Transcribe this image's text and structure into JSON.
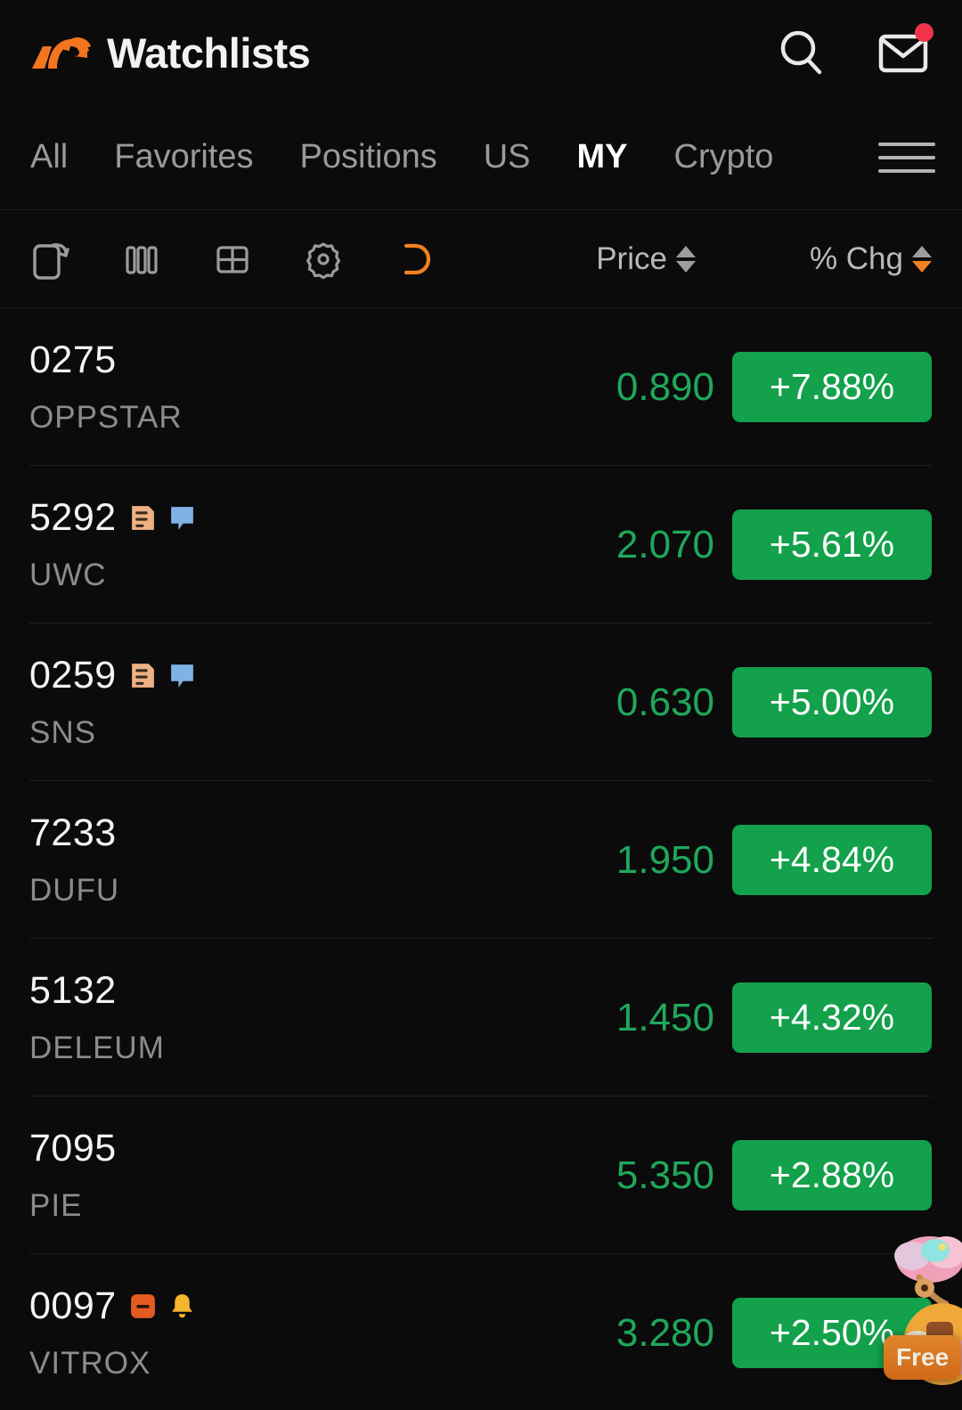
{
  "header": {
    "title": "Watchlists",
    "logo_icon": "moomoo-bull-logo",
    "search_icon": "search-icon",
    "mail_icon": "mail-icon",
    "mail_has_unread": true,
    "accent_color": "#f47520"
  },
  "tabs": {
    "items": [
      {
        "label": "All",
        "active": false
      },
      {
        "label": "Favorites",
        "active": false
      },
      {
        "label": "Positions",
        "active": false
      },
      {
        "label": "US",
        "active": false
      },
      {
        "label": "MY",
        "active": true
      },
      {
        "label": "Crypto",
        "active": false
      }
    ],
    "menu_icon": "hamburger-menu-icon"
  },
  "toolbar": {
    "icons": [
      {
        "name": "rotate-screen-icon",
        "active": false
      },
      {
        "name": "columns-view-icon",
        "active": false
      },
      {
        "name": "grid-view-icon",
        "active": false
      },
      {
        "name": "settings-gear-icon",
        "active": false
      },
      {
        "name": "undo-refresh-icon",
        "active": true
      }
    ],
    "sorts": [
      {
        "label": "Price",
        "direction": "none"
      },
      {
        "label": "% Chg",
        "direction": "desc"
      }
    ]
  },
  "colors": {
    "background": "#0b0b0c",
    "up_green": "#13a14b",
    "price_green": "#1fa85a",
    "divider": "#202023",
    "accent_orange": "#f08020",
    "badge_note": "#edb183",
    "badge_bubble": "#7fb2e5",
    "badge_minus": "#e35b22",
    "badge_bell": "#f5b52a"
  },
  "list": {
    "rows": [
      {
        "code": "0275",
        "name": "OPPSTAR",
        "price": "0.890",
        "pct": "+7.88%",
        "badges": []
      },
      {
        "code": "5292",
        "name": "UWC",
        "price": "2.070",
        "pct": "+5.61%",
        "badges": [
          "note-icon",
          "speech-bubble-icon"
        ]
      },
      {
        "code": "0259",
        "name": "SNS",
        "price": "0.630",
        "pct": "+5.00%",
        "badges": [
          "note-icon",
          "speech-bubble-icon"
        ]
      },
      {
        "code": "7233",
        "name": "DUFU",
        "price": "1.950",
        "pct": "+4.84%",
        "badges": []
      },
      {
        "code": "5132",
        "name": "DELEUM",
        "price": "1.450",
        "pct": "+4.32%",
        "badges": []
      },
      {
        "code": "7095",
        "name": "PIE",
        "price": "5.350",
        "pct": "+2.88%",
        "badges": []
      },
      {
        "code": "0097",
        "name": "VITROX",
        "price": "3.280",
        "pct": "+2.50%",
        "badges": [
          "minus-square-icon",
          "bell-icon"
        ]
      }
    ]
  },
  "overlay": {
    "mascot_icon": "mascot-floating-widget",
    "chip_label": "Free"
  }
}
